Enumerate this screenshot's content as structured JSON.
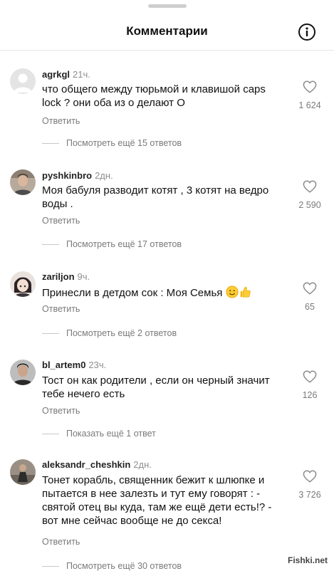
{
  "header": {
    "title": "Комментарии",
    "info_icon": "info-icon"
  },
  "comments": [
    {
      "username": "agrkgl",
      "time": "21ч.",
      "text": "что общего между тюрьмой и клавишой caps lock ? они оба из о делают О",
      "reply": "Ответить",
      "likes": "1 624",
      "more": "Посмотреть ещё 15 ответов",
      "avatar": "default-avatar"
    },
    {
      "username": "pyshkinbro",
      "time": "2дн.",
      "text": "Моя бабуля разводит котят , 3 котят на ведро воды .",
      "reply": "Ответить",
      "likes": "2 590",
      "more": "Посмотреть ещё 17 ответов",
      "avatar": "photo-avatar"
    },
    {
      "username": "zariljon",
      "time": "9ч.",
      "text": "Принесли в детдом сок : Моя Семья",
      "reply": "Ответить",
      "likes": "65",
      "more": "Посмотреть ещё 2 ответов",
      "avatar": "anime-avatar"
    },
    {
      "username": "bl_artem0",
      "time": "23ч.",
      "text": "Тост он как родители , если он черный значит тебе нечего есть",
      "reply": "Ответить",
      "likes": "126",
      "more": "Показать ещё 1 ответ",
      "avatar": "photo-avatar"
    },
    {
      "username": "aleksandr_cheshkin",
      "time": "2дн.",
      "text": "Тонет корабль, священник бежит к шлюпке и пытается в нее залезть и тут ему говорят : - святой отец вы куда, там же ещё дети есть!? - вот мне сейчас вообще не до секса!",
      "reply": "Ответить",
      "likes": "3 726",
      "more": "Посмотреть ещё 30 ответов",
      "avatar": "photo-avatar"
    }
  ],
  "watermark": "Fishki.net",
  "colors": {
    "secondary_text": "#7a7a7a",
    "divider": "#e5e5e5"
  }
}
